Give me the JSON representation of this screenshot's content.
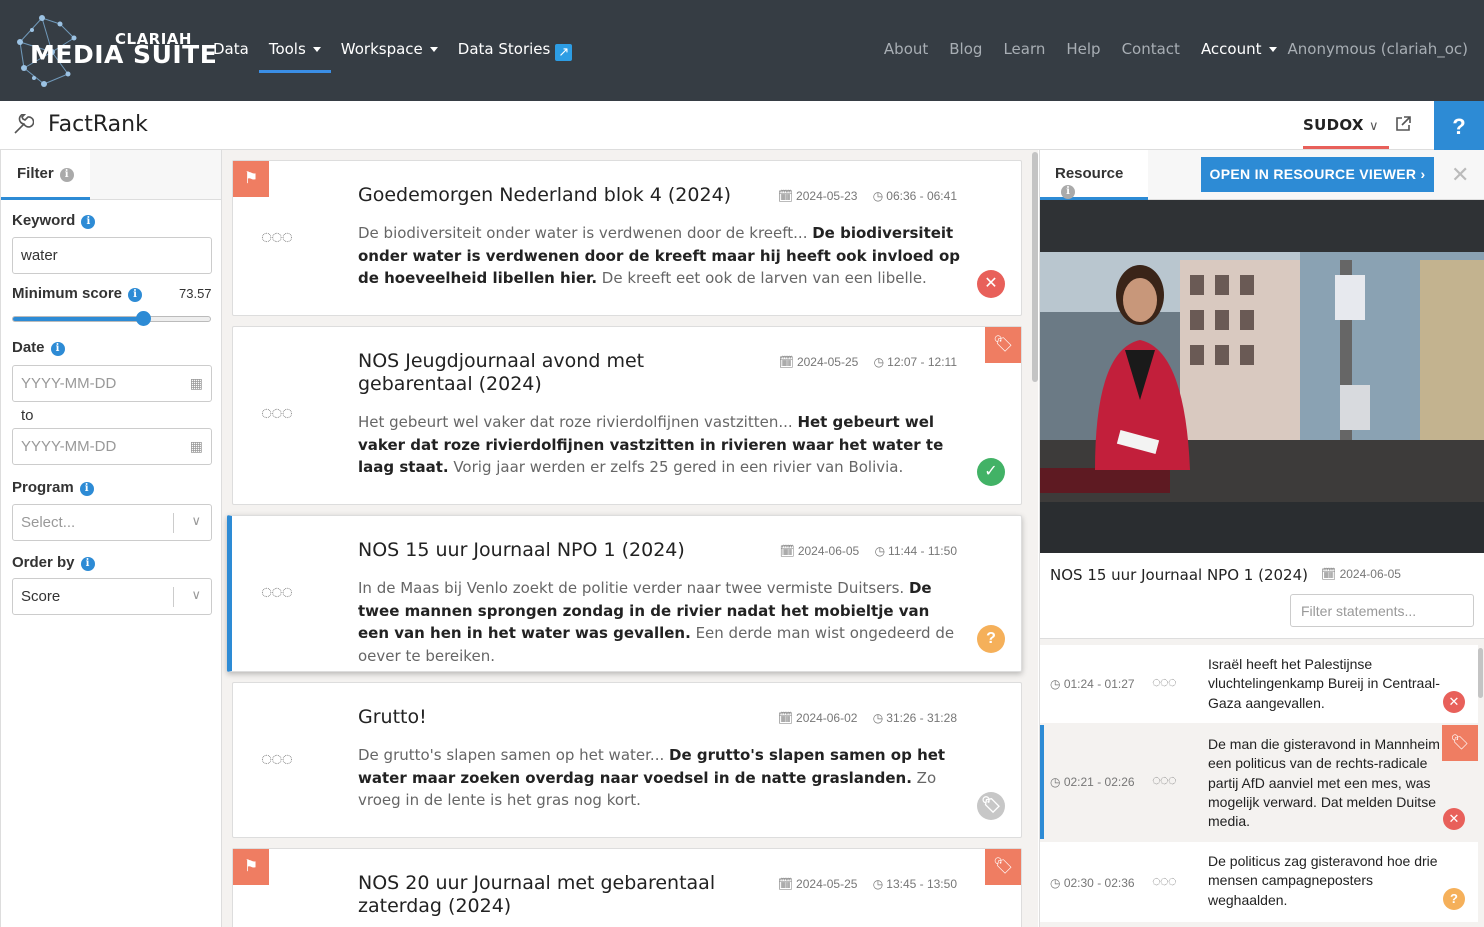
{
  "navbar": {
    "logo_top": "CLARIAH",
    "logo_main": "MEDIA SUITE",
    "left_items": [
      {
        "label": "Data"
      },
      {
        "label": "Tools"
      },
      {
        "label": "Workspace"
      },
      {
        "label": "Data Stories"
      }
    ],
    "right_items": [
      {
        "label": "About"
      },
      {
        "label": "Blog"
      },
      {
        "label": "Learn"
      },
      {
        "label": "Help"
      },
      {
        "label": "Contact"
      }
    ],
    "account_label": "Account",
    "user_label": "Anonymous (clariah_oc)"
  },
  "tool": {
    "title": "FactRank",
    "model_label": "SUDOX",
    "help_label": "?"
  },
  "filter": {
    "tab_label": "Filter",
    "keyword_label": "Keyword",
    "keyword_value": "water",
    "min_score_label": "Minimum score",
    "min_score_value": "73.57",
    "min_score_fraction": 0.66,
    "date_label": "Date",
    "date_from_placeholder": "YYYY-MM-DD",
    "date_to_label": "to",
    "date_to_placeholder": "YYYY-MM-DD",
    "program_label": "Program",
    "program_placeholder": "Select...",
    "order_label": "Order by",
    "order_value": "Score"
  },
  "results": [
    {
      "title": "Goedemorgen Nederland blok 4 (2024)",
      "date": "2024-05-23",
      "time": "06:36 - 06:41",
      "text_pre": "De biodiversiteit onder water is verdwenen door de kreeft... ",
      "text_bold": "De biodiversiteit onder water is verdwenen door de kreeft maar hij heeft ook invloed op de hoeveelheid libellen hier.",
      "text_post": " De kreeft eet ook de larven van een libelle.",
      "status": "rejected",
      "bookmarked": true,
      "tagged": false
    },
    {
      "title": "NOS Jeugdjournaal avond met gebarentaal (2024)",
      "date": "2024-05-25",
      "time": "12:07 - 12:11",
      "text_pre": "Het gebeurt wel vaker dat roze rivierdolfijnen vastzitten... ",
      "text_bold": "Het gebeurt wel vaker dat roze rivierdolfijnen vastzitten in rivieren waar het water te laag staat.",
      "text_post": " Vorig jaar werden er zelfs 25 gered in een rivier van Bolivia.",
      "status": "approved",
      "bookmarked": false,
      "tagged": true
    },
    {
      "title": "NOS 15 uur Journaal NPO 1 (2024)",
      "date": "2024-06-05",
      "time": "11:44 - 11:50",
      "text_pre": "In de Maas bij Venlo zoekt de politie verder naar twee vermiste Duitsers. ",
      "text_bold": "De twee mannen sprongen zondag in de rivier nadat het mobieltje van een van hen in het water was gevallen.",
      "text_post": " Een derde man wist ongedeerd de oever te bereiken.",
      "status": "unknown",
      "bookmarked": false,
      "tagged": false
    },
    {
      "title": "Grutto!",
      "date": "2024-06-02",
      "time": "31:26 - 31:28",
      "text_pre": "De grutto's slapen samen op het water... ",
      "text_bold": "De grutto's slapen samen op het water maar zoeken overdag naar voedsel in de natte graslanden.",
      "text_post": " Zo vroeg in de lente is het gras nog kort.",
      "status": "untagged",
      "bookmarked": false,
      "tagged": false
    },
    {
      "title": "NOS 20 uur Journaal met gebarentaal zaterdag (2024)",
      "date": "2024-05-25",
      "time": "13:45 - 13:50",
      "bookmarked": true,
      "tagged": true
    }
  ],
  "resource": {
    "tab_label": "Resource",
    "open_button": "OPEN IN RESOURCE VIEWER",
    "title": "NOS 15 uur Journaal NPO 1 (2024)",
    "date": "2024-06-05",
    "filter_placeholder": "Filter statements...",
    "statements": [
      {
        "time": "01:24 - 01:27",
        "text": "Israël heeft het Palestijnse vluchtelingenkamp Bureij in Centraal-Gaza aangevallen.",
        "status": "rejected"
      },
      {
        "time": "02:21 - 02:26",
        "text": "De man die gisteravond in Mannheim een politicus van de rechts-radicale partij AfD aanviel met een mes, was mogelijk verward. Dat melden Duitse media.",
        "status": "rejected"
      },
      {
        "time": "02:30 - 02:36",
        "text": "De politicus zag gisteravond hoe drie mensen campagneposters weghaalden.",
        "status": "unknown"
      }
    ]
  },
  "colors": {
    "navbar_bg": "#363d44",
    "accent": "#2d8bd5",
    "tag_orange": "#ef7d62",
    "status_red": "#e8605a",
    "status_green": "#42b266",
    "status_orange": "#f5b05a"
  }
}
